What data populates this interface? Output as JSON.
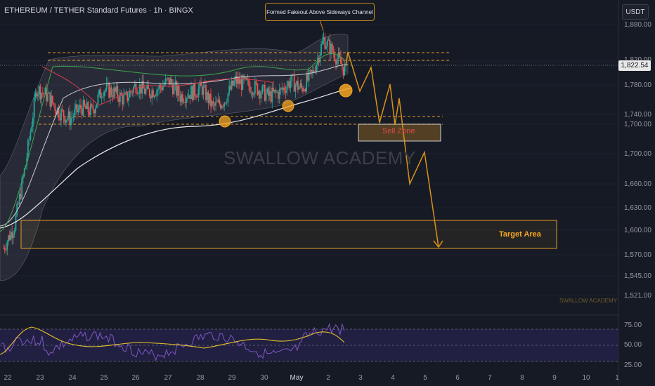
{
  "header": {
    "title": "ETHEREUM / TETHER Standard Futures · 1h · BINGX",
    "currency": "USDT"
  },
  "annotation": {
    "callout": "Formed Fakeout Above Sideways Channel",
    "sell_zone": "Sell Zone",
    "target_area": "Target Area"
  },
  "watermark": {
    "main": "SWALLOW ACADEMY",
    "small": "SWALLOW ACADEMY"
  },
  "current_price": "1,822.54",
  "y_axis": {
    "ticks": [
      "1,880.00",
      "1,820.00",
      "1,780.00",
      "1,740.00",
      "1,700.00",
      "1,660.00",
      "1,630.00",
      "1,600.00",
      "1,570.00",
      "1,545.00",
      "1,521.00"
    ]
  },
  "rsi_axis": {
    "ticks": [
      "75.00",
      "50.00",
      "25.00"
    ]
  },
  "x_axis": {
    "ticks": [
      "22",
      "23",
      "24",
      "25",
      "26",
      "27",
      "28",
      "29",
      "30",
      "May",
      "2",
      "3",
      "4",
      "5",
      "6",
      "7",
      "8",
      "9",
      "10",
      "1"
    ]
  },
  "colors": {
    "background": "#161a25",
    "bull": "#26a69a",
    "bear": "#ef5350",
    "accent": "#f5a623",
    "ma_white": "#e8e8e8",
    "ma_green": "#3fa34d",
    "rsi_line": "#7e57c2",
    "rsi_ma": "#e6c229"
  },
  "chart_data": {
    "type": "candlestick",
    "title": "ETHEREUM / TETHER Standard Futures · 1h · BINGX",
    "x": [
      "22",
      "23",
      "24",
      "25",
      "26",
      "27",
      "28",
      "29",
      "30",
      "May",
      "2"
    ],
    "ylim": [
      1510,
      1900
    ],
    "series": [
      {
        "values": [
          1590,
          1620,
          1700,
          1800,
          1790,
          1770,
          1760,
          1775,
          1770,
          1800,
          1795,
          1785,
          1805,
          1795,
          1800,
          1810,
          1790,
          1795,
          1800,
          1775,
          1785,
          1810,
          1805,
          1800,
          1790,
          1795,
          1810,
          1800,
          1820,
          1865,
          1845,
          1822
        ]
      }
    ],
    "levels": {
      "channel_top": 1835,
      "channel_inner_top": 1820,
      "channel_inner_bottom": 1750,
      "channel_bottom": 1740,
      "sell_zone": [
        1720,
        1740
      ],
      "target_area": [
        1580,
        1615
      ]
    },
    "projection": [
      1822,
      1845,
      1790,
      1815,
      1740,
      1800,
      1710,
      1700,
      1740,
      1600,
      1580
    ],
    "rsi": {
      "ticks": [
        75,
        50,
        25
      ],
      "bands": [
        70,
        50,
        30
      ]
    }
  }
}
